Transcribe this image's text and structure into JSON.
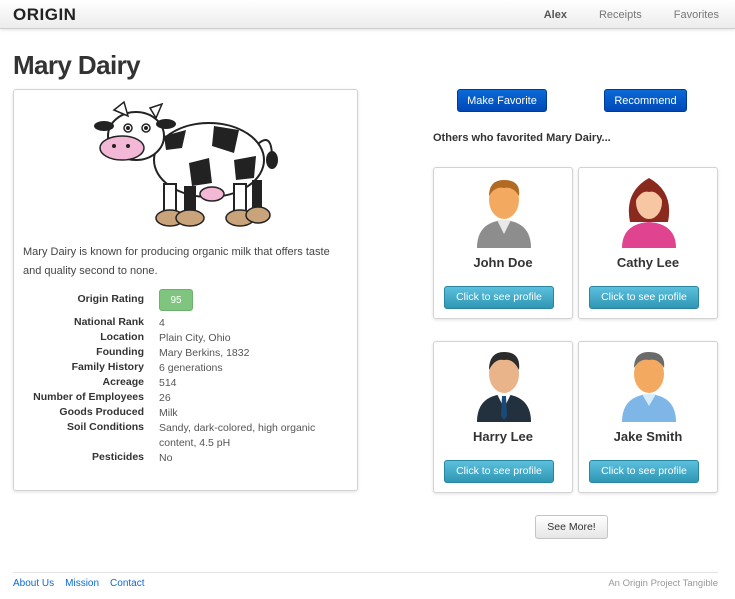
{
  "navbar": {
    "brand": "ORIGIN",
    "items": [
      {
        "label": "Alex",
        "active": true
      },
      {
        "label": "Receipts",
        "active": false
      },
      {
        "label": "Favorites",
        "active": false
      }
    ]
  },
  "farm": {
    "title": "Mary Dairy",
    "description": "Mary Dairy is known for producing organic milk that offers taste and quality second to none.",
    "rating_label": "Origin Rating",
    "rating_value": "95",
    "facts": [
      {
        "label": "National Rank",
        "value": "4"
      },
      {
        "label": "Location",
        "value": "Plain City, Ohio"
      },
      {
        "label": "Founding",
        "value": "Mary Berkins, 1832"
      },
      {
        "label": "Family History",
        "value": "6 generations"
      },
      {
        "label": "Acreage",
        "value": "514"
      },
      {
        "label": "Number of Employees",
        "value": "26"
      },
      {
        "label": "Goods Produced",
        "value": "Milk"
      },
      {
        "label": "Soil Conditions",
        "value": "Sandy, dark-colored, high organic content, 4.5 pH"
      },
      {
        "label": "Pesticides",
        "value": "No"
      }
    ]
  },
  "actions": {
    "favorite": "Make Favorite",
    "recommend": "Recommend"
  },
  "others": {
    "heading": "Others who favorited Mary Dairy...",
    "profile_button": "Click to see profile",
    "people": [
      {
        "name": "John Doe",
        "icon": "man-avatar-icon"
      },
      {
        "name": "Cathy Lee",
        "icon": "woman-avatar-icon"
      },
      {
        "name": "Harry Lee",
        "icon": "businessman-avatar-icon"
      },
      {
        "name": "Jake Smith",
        "icon": "man-avatar-icon"
      }
    ],
    "see_more": "See More!"
  },
  "footer": {
    "links": [
      "About Us",
      "Mission",
      "Contact"
    ],
    "tagline": "An Origin Project Tangible"
  },
  "colors": {
    "primary": "#0a6ad6",
    "info": "#5bc0de",
    "rating_badge": "#7fc47f"
  }
}
